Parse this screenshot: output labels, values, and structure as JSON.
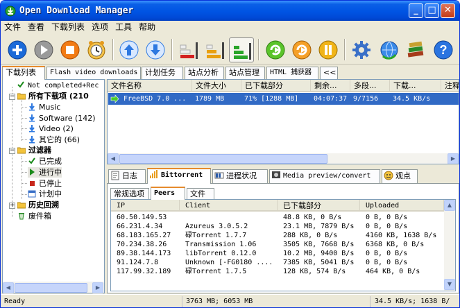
{
  "window": {
    "title": "Open Download Manager"
  },
  "menu": [
    "文件",
    "查看",
    "下载列表",
    "选项",
    "工具",
    "帮助"
  ],
  "toolbar": {
    "buttons": [
      {
        "name": "add-download-button",
        "icon": "plus-icon",
        "color": "#1b6ad8"
      },
      {
        "name": "start-button",
        "icon": "play-icon",
        "color": "#8c8c8c"
      },
      {
        "name": "stop-button",
        "icon": "stop-icon",
        "color": "#f27b14"
      },
      {
        "name": "scheduler-button",
        "icon": "clock-icon",
        "color": "#e59a1c"
      },
      {
        "name": "move-up-button",
        "icon": "arrow-up-icon",
        "color": "#2d78e0"
      },
      {
        "name": "move-down-button",
        "icon": "arrow-down-icon",
        "color": "#2d78e0"
      },
      {
        "name": "speed-low-button",
        "icon": "speed-low-icon",
        "color": "#d32020"
      },
      {
        "name": "speed-medium-button",
        "icon": "speed-medium-icon",
        "color": "#e8a010"
      },
      {
        "name": "speed-high-button",
        "icon": "speed-high-icon",
        "color": "#2aa52a"
      },
      {
        "name": "refresh-green-button",
        "icon": "refresh-arrow-icon",
        "color": "#4caf1f"
      },
      {
        "name": "refresh-orange-button",
        "icon": "refresh-arrow-icon",
        "color": "#f08a10"
      },
      {
        "name": "site-manager-button",
        "icon": "site-icon",
        "color": "#f0b419"
      },
      {
        "name": "settings-button",
        "icon": "gear-icon",
        "color": "#3a70c8"
      },
      {
        "name": "update-button",
        "icon": "globe-refresh-icon",
        "color": "#2b64c0"
      },
      {
        "name": "books-button",
        "icon": "books-icon",
        "color": "#a63c1b"
      },
      {
        "name": "help-button",
        "icon": "help-icon",
        "color": "#2a74e0"
      }
    ]
  },
  "main_tabs": [
    {
      "label": "下载列表",
      "selected": true
    },
    {
      "label": "Flash video downloads"
    },
    {
      "label": "计划任务"
    },
    {
      "label": "站点分析"
    },
    {
      "label": "站点管理"
    },
    {
      "label": "HTML 捕获器"
    },
    {
      "label": "<<"
    }
  ],
  "tree": {
    "items": [
      {
        "label": "Not completed+Rec",
        "icon": "check-icon",
        "color": "#1a8a1a"
      },
      {
        "label": "所有下载项 (210",
        "icon": "folder-icon"
      },
      {
        "label": "Music",
        "icon": "arrow-down-small-icon"
      },
      {
        "label": "Software (142)",
        "icon": "arrow-down-small-icon"
      },
      {
        "label": "Video (2)",
        "icon": "arrow-down-small-icon"
      },
      {
        "label": "其它的 (66)",
        "icon": "arrow-down-small-icon"
      },
      {
        "label": "过滤器",
        "icon": "folder-icon"
      },
      {
        "label": "已完成",
        "icon": "check-icon"
      },
      {
        "label": "进行中",
        "icon": "play-small-icon"
      },
      {
        "label": "已停止",
        "icon": "stop-small-icon"
      },
      {
        "label": "计划中",
        "icon": "calendar-icon"
      },
      {
        "label": "历史回溯",
        "icon": "folder-icon"
      },
      {
        "label": "废件箱",
        "icon": "recycle-icon"
      }
    ]
  },
  "downloads": {
    "columns": [
      "文件名称",
      "文件大小",
      "已下载部分",
      "剩余...",
      "多段...",
      "下载...",
      "注释"
    ],
    "rows": [
      {
        "name": "FreeBSD 7.0 ...",
        "size": "1789 MB",
        "downloaded": "71% [1288 MB]",
        "remaining": "04:07:37",
        "sections": "9/7156",
        "speed": "34.5 KB/s",
        "comment": ""
      }
    ]
  },
  "detail_tabs": [
    {
      "label": "日志",
      "icon": "log-icon"
    },
    {
      "label": "Bittorrent",
      "icon": "bittorrent-icon",
      "selected": true
    },
    {
      "label": "进程状况",
      "icon": "progress-icon"
    },
    {
      "label": "Media preview/convert",
      "icon": "media-icon"
    },
    {
      "label": "观点",
      "icon": "opinion-icon"
    }
  ],
  "bt_tabs": [
    {
      "label": "常规选项"
    },
    {
      "label": "Peers",
      "selected": true
    },
    {
      "label": "文件"
    }
  ],
  "peers": {
    "columns": [
      "IP",
      "Client",
      "已下载部分",
      "Uploaded"
    ],
    "rows": [
      {
        "ip": "60.50.149.53",
        "client": "",
        "downloaded": "48.8 KB, 0 B/s",
        "uploaded": "0 B, 0 B/s"
      },
      {
        "ip": "66.231.4.34",
        "client": "Azureus 3.0.5.2",
        "downloaded": "23.1 MB, 7879 B/s",
        "uploaded": "0 B, 0 B/s"
      },
      {
        "ip": "68.183.165.27",
        "client": "碌Torrent 1.7.7",
        "downloaded": "288 KB, 0 B/s",
        "uploaded": "4160 KB, 1638 B/s"
      },
      {
        "ip": "70.234.38.26",
        "client": "Transmission 1.06",
        "downloaded": "3505 KB, 7668 B/s",
        "uploaded": "6368 KB, 0 B/s"
      },
      {
        "ip": "89.38.144.173",
        "client": "libTorrent 0.12.0",
        "downloaded": "10.2 MB, 9400 B/s",
        "uploaded": "0 B, 0 B/s"
      },
      {
        "ip": "91.124.7.8",
        "client": "Unknown [-FG0180 ....",
        "downloaded": "7385 KB, 5041 B/s",
        "uploaded": "0 B, 0 B/s"
      },
      {
        "ip": "117.99.32.189",
        "client": "碌Torrent 1.7.5",
        "downloaded": "128 KB, 574 B/s",
        "uploaded": "464 KB, 0 B/s"
      }
    ]
  },
  "status": {
    "state": "Ready",
    "disk": "3763 MB; 6053 MB",
    "speed": "34.5 KB/s; 1638 B/"
  }
}
